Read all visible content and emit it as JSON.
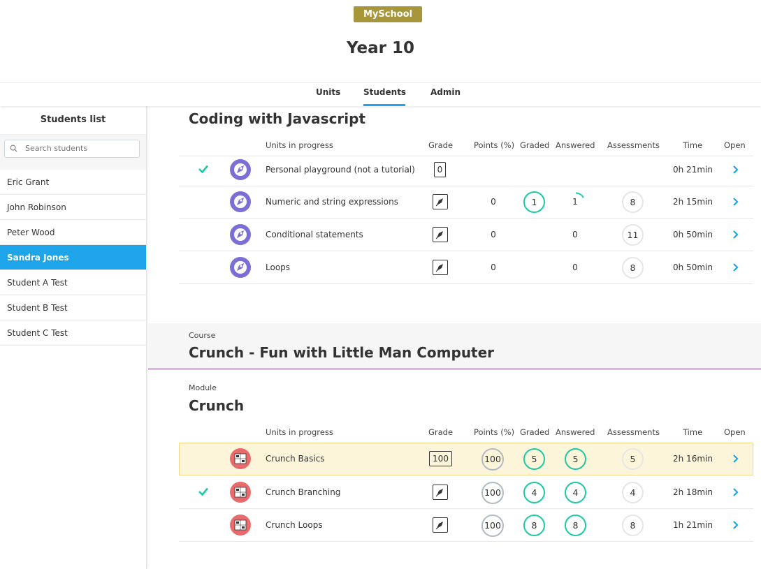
{
  "header": {
    "brand": "MySchool",
    "title": "Year 10"
  },
  "nav": {
    "tabs": [
      {
        "label": "Units"
      },
      {
        "label": "Students",
        "active": true
      },
      {
        "label": "Admin"
      }
    ]
  },
  "sidebar": {
    "title": "Students list",
    "search_placeholder": "Search students",
    "students": [
      {
        "name": "Eric Grant"
      },
      {
        "name": "John Robinson"
      },
      {
        "name": "Peter Wood"
      },
      {
        "name": "Sandra Jones",
        "selected": true
      },
      {
        "name": "Student A Test"
      },
      {
        "name": "Student B Test"
      },
      {
        "name": "Student C Test"
      }
    ]
  },
  "columns": {
    "units": "Units in progress",
    "grade": "Grade",
    "points": "Points (%)",
    "graded": "Graded",
    "answered": "Answered",
    "assessments": "Assessments",
    "time": "Time",
    "open": "Open"
  },
  "section1": {
    "title": "Coding with Javascript",
    "rows": [
      {
        "name": "Personal playground (not a tutorial)",
        "grade": "0",
        "time": "0h 21min",
        "completed": true
      },
      {
        "name": "Numeric and string expressions",
        "grade_icon": "pen-icon",
        "points": "0",
        "graded": "1",
        "answered": "1",
        "assessments": "8",
        "time": "2h 15min"
      },
      {
        "name": "Conditional statements",
        "grade_icon": "pen-icon",
        "points": "0",
        "answered": "0",
        "assessments": "11",
        "time": "0h 50min"
      },
      {
        "name": "Loops",
        "grade_icon": "pen-icon",
        "points": "0",
        "answered": "0",
        "assessments": "8",
        "time": "0h 50min"
      }
    ]
  },
  "course": {
    "label": "Course",
    "title": "Crunch - Fun with Little Man Computer"
  },
  "module": {
    "label": "Module",
    "title": "Crunch",
    "rows": [
      {
        "name": "Crunch Basics",
        "grade": "100",
        "points": "100",
        "graded": "5",
        "answered": "5",
        "assessments": "5",
        "time": "2h 16min",
        "highlighted": true
      },
      {
        "name": "Crunch Branching",
        "grade_icon": "pen-icon",
        "points": "100",
        "graded": "4",
        "answered": "4",
        "assessments": "4",
        "time": "2h 18min",
        "completed": true
      },
      {
        "name": "Crunch Loops",
        "grade_icon": "pen-icon",
        "points": "100",
        "graded": "8",
        "answered": "8",
        "assessments": "8",
        "time": "1h 21min"
      }
    ]
  },
  "colors": {
    "accent": "#1ea4e8",
    "brand": "#a8963a",
    "green": "#1dc9a4",
    "js_icon": "#7b6fd6",
    "crunch_icon": "#e86a6a",
    "course_line": "#7b3b8c"
  }
}
